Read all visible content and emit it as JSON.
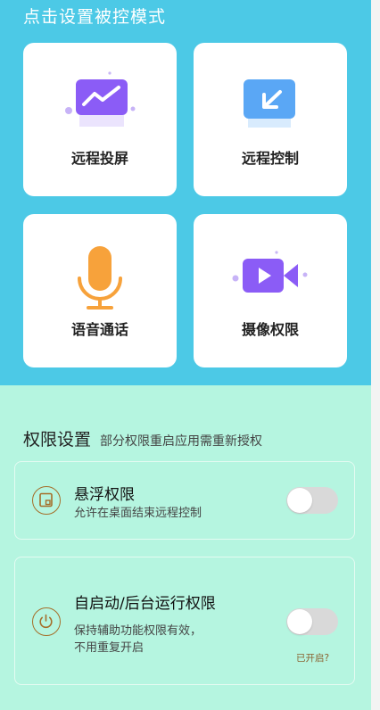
{
  "remote_section": {
    "title": "点击设置被控模式",
    "cards": [
      {
        "label": "远程投屏",
        "icon": "screen-cast-icon"
      },
      {
        "label": "远程控制",
        "icon": "remote-control-icon"
      },
      {
        "label": "语音通话",
        "icon": "microphone-icon"
      },
      {
        "label": "摄像权限",
        "icon": "video-camera-icon"
      }
    ]
  },
  "permissions": {
    "title": "权限设置",
    "subtitle": "部分权限重启应用需重新授权",
    "items": [
      {
        "name": "悬浮权限",
        "description": "允许在桌面结束远程控制",
        "enabled": false,
        "icon": "floating-window-icon"
      },
      {
        "name": "自启动/后台运行权限",
        "description_lines": [
          "保持辅助功能权限有效，",
          "不用重复开启"
        ],
        "enabled": false,
        "status_link": "已开启?",
        "icon": "power-icon"
      }
    ]
  },
  "colors": {
    "top_background": "#4cc9e6",
    "bottom_background": "#b5f5e0",
    "icon_purple": "#8b5cf6",
    "icon_blue": "#5aa7f5",
    "icon_orange": "#f7a23b",
    "accent_brown": "#a56e2a"
  }
}
